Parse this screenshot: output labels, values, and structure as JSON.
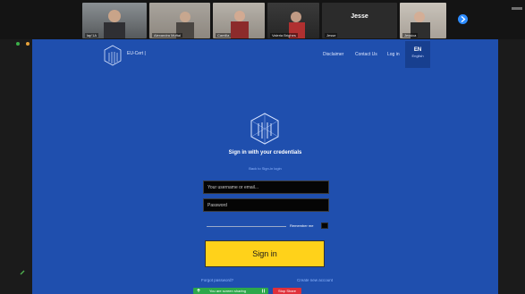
{
  "participants": [
    {
      "name": "lap'1A",
      "big": ""
    },
    {
      "name": "Alexandra Muftai",
      "big": ""
    },
    {
      "name": "Camilla",
      "big": ""
    },
    {
      "name": "Valeria Brighes",
      "big": ""
    },
    {
      "name": "Jesse",
      "big": "Jesse"
    },
    {
      "name": "Jessica",
      "big": ""
    }
  ],
  "site": {
    "brand": "EU-Cert |",
    "nav": [
      "Disclaimer",
      "Contact Us",
      "Log in"
    ],
    "lang_code": "EN",
    "lang_name": "English"
  },
  "form": {
    "title": "Sign in with your credentials",
    "subtitle": "Back to Sign-in login",
    "username_placeholder": "Your username or email...",
    "password_placeholder": "Password",
    "remember_label": "Remember me",
    "signin_label": "Sign in",
    "forgot_link": "Forgot password?",
    "create_link": "Create new account"
  },
  "share_bar": {
    "status": "You are screen sharing",
    "stop": "Stop Share"
  },
  "colors": {
    "page_blue": "#1f4fae",
    "button_yellow": "#ffd21a",
    "zoom_blue": "#2d8cff",
    "share_green": "#2ca84a",
    "stop_red": "#e0303a"
  }
}
